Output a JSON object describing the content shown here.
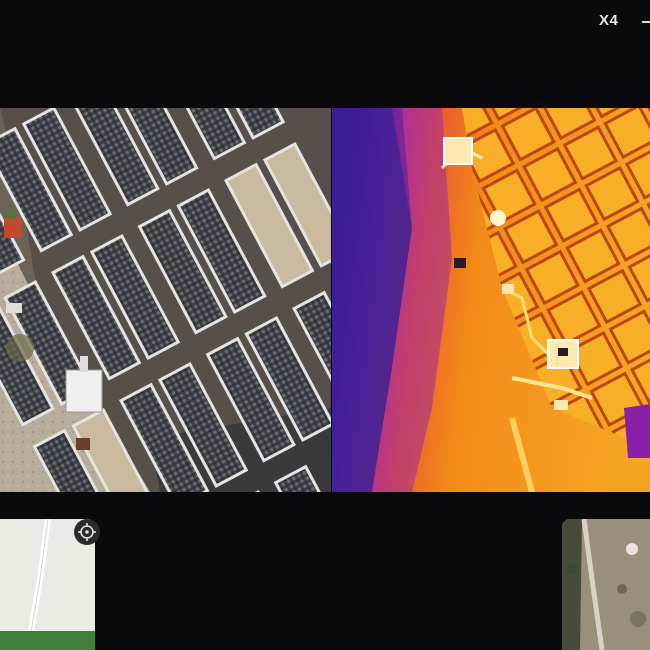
{
  "top_bar": {
    "zoom_label": "X4"
  },
  "views": {
    "visual": {
      "icon": "visible-camera-feed"
    },
    "thermal": {
      "icon": "thermal-camera-feed",
      "palette": [
        "#3a1a8c",
        "#8a1fa8",
        "#d43a8a",
        "#f07018",
        "#f8a020",
        "#fde070"
      ]
    }
  },
  "thumbnails": {
    "map": {
      "icon": "locate-crosshair-icon"
    },
    "camera": {
      "icon": "aerial-camera-thumb"
    }
  },
  "colors": {
    "background": "#0a0a0c",
    "ground": "#5a534c",
    "bed_frame": "#d8d8d4",
    "thermal_hot": "#fde070",
    "thermal_cool": "#3a1a8c"
  }
}
